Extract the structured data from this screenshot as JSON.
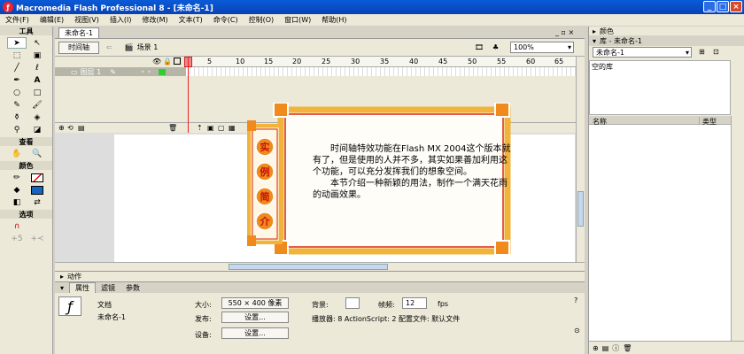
{
  "window": {
    "title": "Macromedia Flash Professional 8 - [未命名-1]"
  },
  "menu": [
    "文件(F)",
    "编辑(E)",
    "视图(V)",
    "插入(I)",
    "修改(M)",
    "文本(T)",
    "命令(C)",
    "控制(O)",
    "窗口(W)",
    "帮助(H)"
  ],
  "toolbox": {
    "title": "工具",
    "view_title": "查看",
    "colors_title": "颜色",
    "options_title": "选项"
  },
  "document": {
    "tab": "未命名-1",
    "timeline_button": "时间轴",
    "scene": "场景 1",
    "zoom": "100%",
    "ruler_ticks": [
      "1",
      "5",
      "10",
      "15",
      "20",
      "25",
      "30",
      "35",
      "40",
      "45",
      "50",
      "55",
      "60",
      "65"
    ],
    "layer_name": "图层 1"
  },
  "stage": {
    "banner_chars": [
      "实",
      "例",
      "简",
      "介"
    ],
    "para1": "时间轴特效功能在Flash MX 2004这个版本就有了，但是使用的人并不多，其实如果善加利用这个功能，可以充分发挥我们的想象空间。",
    "para2": "本节介绍一种新颖的用法，制作一个满天花雨的动画效果。"
  },
  "actions_panel": {
    "title": "动作"
  },
  "properties": {
    "tabs": [
      "属性",
      "滤镜",
      "参数"
    ],
    "type": "文档",
    "doc_name": "未命名-1",
    "size_label": "大小:",
    "size_value": "550 × 400 像素",
    "background_label": "背景:",
    "fps_label": "帧频:",
    "fps_value": "12",
    "fps_unit": "fps",
    "publish_label": "发布:",
    "settings_button": "设置...",
    "player_info": "播放器: 8   ActionScript: 2    配置文件: 默认文件",
    "device_label": "设备:",
    "device_button": "设置..."
  },
  "right_panel": {
    "color_title": "颜色",
    "library_title": "库 - 未命名-1",
    "library_doc": "未命名-1",
    "empty_text": "空的库",
    "col_name": "名称",
    "col_type": "类型"
  },
  "colors": {
    "title_bg": "#0a5bd8",
    "orange": "#f08a1c",
    "red": "#d62a10",
    "frame_gold": "#f2b33c"
  }
}
